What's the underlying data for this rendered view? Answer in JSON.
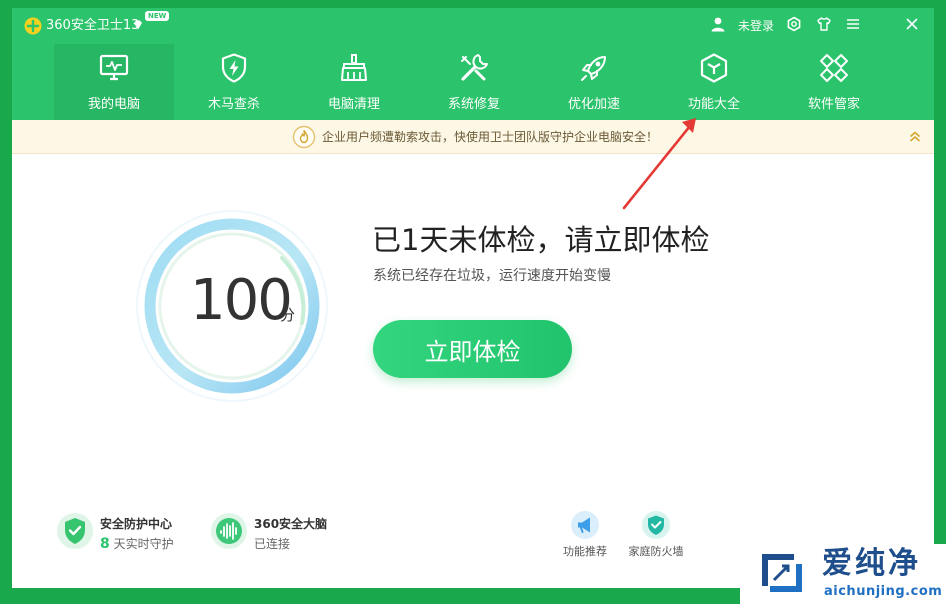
{
  "app": {
    "title": "360安全卫士13",
    "new_badge": "NEW",
    "login_text": "未登录"
  },
  "nav": [
    {
      "label": "我的电脑",
      "icon": "monitor-icon",
      "active": true
    },
    {
      "label": "木马查杀",
      "icon": "shield-lightning-icon"
    },
    {
      "label": "电脑清理",
      "icon": "broom-icon"
    },
    {
      "label": "系统修复",
      "icon": "wrench-icon"
    },
    {
      "label": "优化加速",
      "icon": "rocket-icon"
    },
    {
      "label": "功能大全",
      "icon": "cube-icon"
    },
    {
      "label": "软件管家",
      "icon": "apps-icon"
    }
  ],
  "notice": {
    "text": "企业用户频遭勒索攻击，快使用卫士团队版守护企业电脑安全！"
  },
  "score": {
    "value": "100",
    "unit": "分"
  },
  "main": {
    "headline": "已1天未体检，请立即体检",
    "subline": "系统已经存在垃圾，运行速度开始变慢",
    "button": "立即体检"
  },
  "bottom": {
    "security_center": {
      "title": "安全防护中心",
      "count": "8",
      "sub": "天实时守护"
    },
    "brain": {
      "title": "360安全大脑",
      "sub": "已连接"
    },
    "tools": [
      {
        "label": "功能推荐"
      },
      {
        "label": "家庭防火墙"
      }
    ]
  },
  "watermark": {
    "cn": "爱纯净",
    "en": "aichunjing.com"
  },
  "colors": {
    "brand_green": "#2bc36b",
    "active_tab": "#27b663",
    "notice_bg": "#fdf7e6",
    "arrow_red": "#e53935"
  }
}
